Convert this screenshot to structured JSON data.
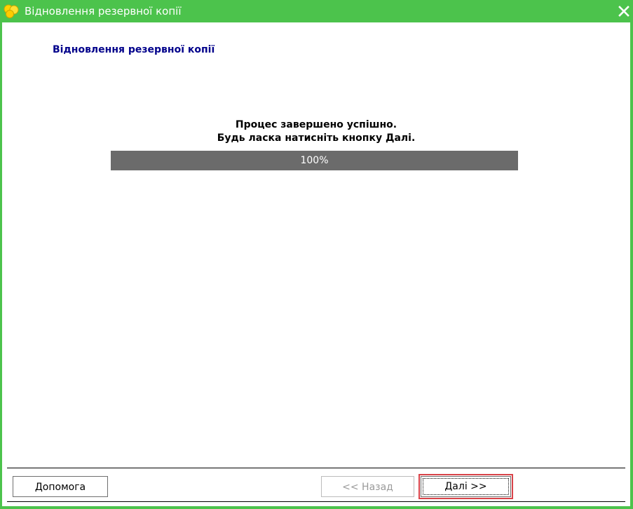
{
  "window": {
    "title": "Відновлення резервної копії",
    "accent_color": "#4cc34c",
    "icon": "app-logo-icon",
    "close_icon": "close-icon"
  },
  "main": {
    "heading": "Відновлення резервної копії",
    "status_line_1": "Процес завершено успішно.",
    "status_line_2": "Будь ласка натисніть кнопку Далі.",
    "progress": {
      "value": 100,
      "label": "100%"
    }
  },
  "footer": {
    "help_label": "Допомога",
    "back_label": "<< Назад",
    "back_enabled": false,
    "next_label": "Далі >>"
  }
}
